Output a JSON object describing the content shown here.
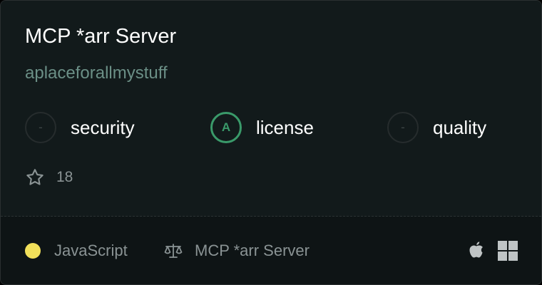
{
  "card": {
    "title": "MCP *arr Server",
    "owner": "aplaceforallmystuff",
    "scores": [
      {
        "label": "security",
        "grade": "-"
      },
      {
        "label": "license",
        "grade": "A"
      },
      {
        "label": "quality",
        "grade": "-"
      }
    ],
    "stars": "18",
    "language": {
      "name": "JavaScript",
      "color": "#f1e05a"
    },
    "license_name": "MCP *arr Server",
    "platforms": [
      "apple-icon",
      "windows-icon"
    ],
    "colors": {
      "grade_a": "#3a9a6a",
      "owner": "#6b8f86"
    }
  }
}
